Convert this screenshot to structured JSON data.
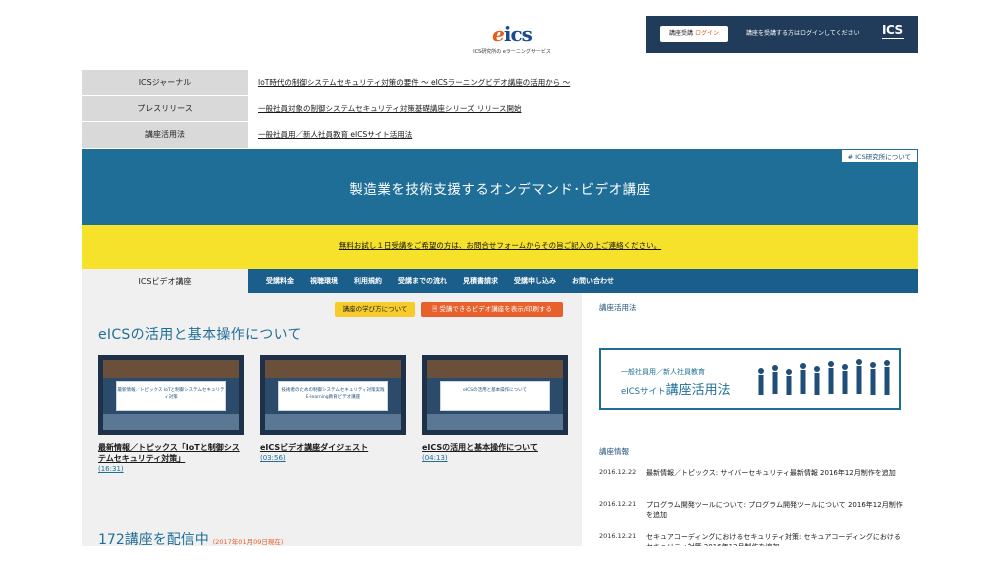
{
  "header": {
    "logo_mark_e": "e",
    "logo_mark_rest": "ics",
    "logo_subtitle": "ICS研究所の eラーニングサービス",
    "login_button_prefix": "講座受講",
    "login_button_accent": "ログイン",
    "login_message": "講座を受講する方はログインしてください",
    "corp_logo": "ICS"
  },
  "info_rows": [
    {
      "label": "ICSジャーナル",
      "value": "IoT時代の制御システムセキュリティ対策の要件 ～ eICSラーニングビデオ講座の活用から ～"
    },
    {
      "label": "プレスリリース",
      "value": "一般社員対象の制御システムセキュリティ対策基礎講座シリーズ リリース開始"
    },
    {
      "label": "講座活用法",
      "value": "一般社員用／新人社員教育 eICSサイト活用法"
    }
  ],
  "banner": {
    "about_link": "ICS研究所について",
    "title": "製造業を技術支援するオンデマンド･ビデオ講座"
  },
  "notice": "無料お試し１日受講をご希望の方は、お問合せフォームからその旨ご記入の上ご連絡ください。",
  "nav": {
    "home": "ICSビデオ講座",
    "items": [
      "受講料金",
      "視聴環境",
      "利用規約",
      "受講までの流れ",
      "見積書請求",
      "受講申し込み",
      "お問い合わせ"
    ]
  },
  "main": {
    "learn_button": "講座の学び方について",
    "print_button": "受講できるビデオ講座を表示/印刷する",
    "section_title": "eICSの活用と基本操作について",
    "videos": [
      {
        "thumb_text": "最新情報／トピックス IoTと制御システムセキュリティ対策",
        "title": "最新情報／トピックス「IoTと制御システムセキュリティ対策」",
        "duration": "(16:31)"
      },
      {
        "thumb_text": "技術者のための制御システムセキュリティ対策実践 E-learning教育ビデオ講座",
        "title": "eICSビデオ講座ダイジェスト",
        "duration": "(03:56)"
      },
      {
        "thumb_text": "eICSの活用と基本操作について",
        "title": "eICSの活用と基本操作について",
        "duration": "(04:13)"
      }
    ],
    "count_text": "172講座を配信中",
    "count_date": "(2017年01月09日現在)"
  },
  "sidebar": {
    "usage_heading": "講座活用法",
    "promo_line1": "一般社員用／新人社員教育",
    "promo_line2_a": "eICSサイト",
    "promo_line2_b": "講座活用法",
    "news_heading": "講座情報",
    "news": [
      {
        "date": "2016.12.22",
        "text": "最新情報／トピックス: サイバーセキュリティ最新情報 2016年12月制作を追加"
      },
      {
        "date": "2016.12.21",
        "text": "プログラム開発ツールについて: プログラム開発ツールについて 2016年12月制作を追加"
      },
      {
        "date": "2016.12.21",
        "text": "セキュアコーディングにおけるセキュリティ対策: セキュアコーディングにおけるセキュリティ対策 2016年12月制作を追加"
      }
    ]
  },
  "colors": {
    "brand_blue": "#1f6e97",
    "nav_blue": "#1a5e8c",
    "notice_yellow": "#f6e12b",
    "accent_orange": "#e8602c",
    "login_navy": "#213c5a"
  }
}
